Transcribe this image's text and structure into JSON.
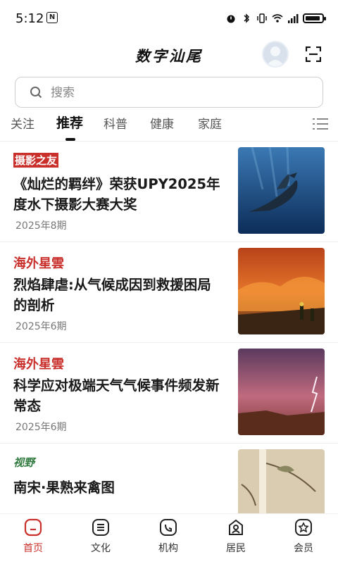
{
  "status": {
    "time": "5:12",
    "time_badge": "N"
  },
  "header": {
    "title": "数字汕尾"
  },
  "search": {
    "placeholder": "搜索"
  },
  "tabs": [
    {
      "label": "关注"
    },
    {
      "label": "推荐",
      "active": true
    },
    {
      "label": "科普"
    },
    {
      "label": "健康"
    },
    {
      "label": "家庭"
    }
  ],
  "feed": [
    {
      "source": "摄影之友",
      "headline": "《灿烂的羁绊》荣获UPY2025年度水下摄影大赛大奖",
      "date": "2025年8期",
      "thumb": "whale-underwater-photo"
    },
    {
      "source": "海外星雲",
      "headline": "烈焰肆虐:从气候成因到救援困局的剖析",
      "date": "2025年6期",
      "thumb": "wildfire-photo"
    },
    {
      "source": "海外星雲",
      "headline": "科学应对极端天气气候事件频发新常态",
      "date": "2025年6期",
      "thumb": "lightning-storm-photo"
    },
    {
      "source": "视野",
      "headline": "南宋·果熟来禽图",
      "date": "",
      "thumb": "song-painting-photo"
    }
  ],
  "nav": [
    {
      "label": "首页",
      "icon": "home-icon",
      "active": true
    },
    {
      "label": "文化",
      "icon": "culture-icon"
    },
    {
      "label": "机构",
      "icon": "institution-icon"
    },
    {
      "label": "居民",
      "icon": "resident-icon"
    },
    {
      "label": "会员",
      "icon": "member-icon"
    }
  ],
  "colors": {
    "accent": "#c9302c",
    "text": "#1a1a1a",
    "muted": "#777777"
  }
}
